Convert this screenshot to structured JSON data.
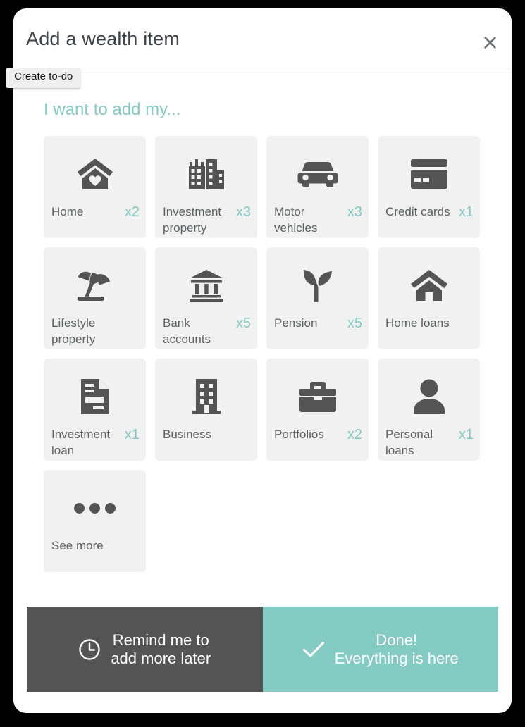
{
  "dialog": {
    "title": "Add a wealth item",
    "close_icon": "close-icon",
    "tooltip_chip": "Create to-do",
    "prompt": "I want to add my..."
  },
  "colors": {
    "accent_teal": "#84cbc4",
    "icon_dark": "#545454",
    "card_bg": "#f1f1f1",
    "title_text": "#3f4448",
    "label_text": "#5c6164",
    "backdrop": "#000000"
  },
  "items": [
    {
      "label": "Home",
      "count": "x2",
      "icon": "home-heart-icon"
    },
    {
      "label": "Investment property",
      "count": "x3",
      "icon": "office-buildings-icon"
    },
    {
      "label": "Motor vehicles",
      "count": "x3",
      "icon": "car-icon"
    },
    {
      "label": "Credit cards",
      "count": "x1",
      "icon": "credit-card-icon"
    },
    {
      "label": "Lifestyle property",
      "count": "",
      "icon": "beach-umbrella-icon"
    },
    {
      "label": "Bank accounts",
      "count": "x5",
      "icon": "bank-icon"
    },
    {
      "label": "Pension",
      "count": "x5",
      "icon": "seedling-icon"
    },
    {
      "label": "Home loans",
      "count": "",
      "icon": "house-icon"
    },
    {
      "label": "Investment loan",
      "count": "x1",
      "icon": "document-icon"
    },
    {
      "label": "Business",
      "count": "",
      "icon": "building-icon"
    },
    {
      "label": "Portfolios",
      "count": "x2",
      "icon": "briefcase-icon"
    },
    {
      "label": "Personal loans",
      "count": "x1",
      "icon": "person-icon"
    },
    {
      "label": "See more",
      "count": "",
      "icon": "ellipsis-icon"
    }
  ],
  "footer": {
    "remind": {
      "icon": "clock-icon",
      "line1": "Remind me to",
      "line2": "add more later"
    },
    "done": {
      "icon": "check-icon",
      "line1": "Done!",
      "line2": "Everything is here"
    }
  }
}
